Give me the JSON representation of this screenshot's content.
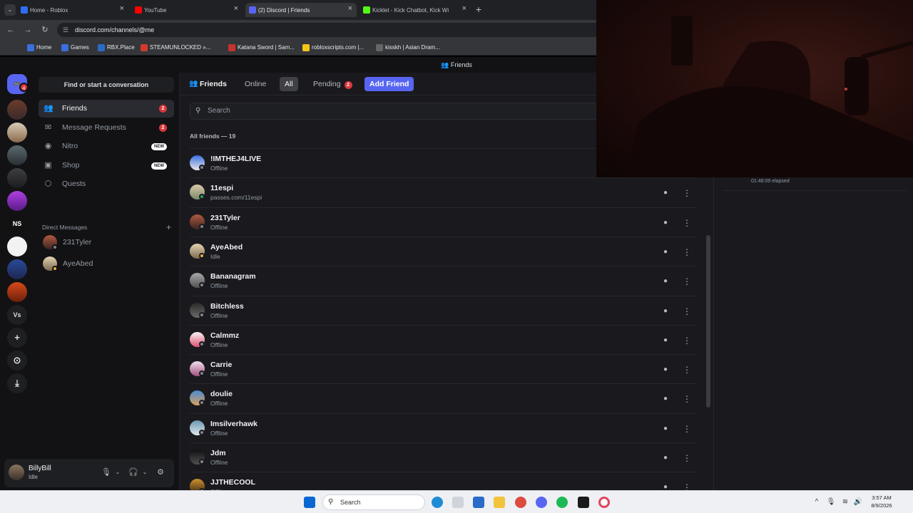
{
  "browser": {
    "tabs": [
      {
        "title": "Home - Roblox",
        "favicon_color": "#2f6df3",
        "active": false
      },
      {
        "title": "YouTube",
        "favicon_color": "#ff0000",
        "active": false
      },
      {
        "title": "(2) Discord | Friends",
        "favicon_color": "#5865f2",
        "active": true
      },
      {
        "title": "Kicklet - Kick Chatbot, Kick Wi",
        "favicon_color": "#53fc18",
        "active": false
      }
    ],
    "url": "discord.com/channels/@me",
    "bookmarks": [
      "Home",
      "Games",
      "RBX.Place",
      "STEAMUNLOCKED »...",
      "Katana Sword | Sam...",
      "robloxscripts.com |...",
      "kisskh | Asian Dram..."
    ]
  },
  "discord": {
    "window_title": "Friends",
    "home_badge": "4",
    "server_label_ns": "NS",
    "server_label_vs": "Vs",
    "find_conversation": "Find or start a conversation",
    "nav": [
      {
        "label": "Friends",
        "icon": "friends-icon",
        "badge": "2"
      },
      {
        "label": "Message Requests",
        "icon": "mail-icon",
        "badge": "2"
      },
      {
        "label": "Nitro",
        "icon": "nitro-icon",
        "tag": "NEW"
      },
      {
        "label": "Shop",
        "icon": "shop-icon",
        "tag": "NEW"
      },
      {
        "label": "Quests",
        "icon": "quests-icon"
      }
    ],
    "direct_messages_label": "Direct Messages",
    "dms": [
      {
        "name": "231Tyler",
        "status_color": "#80848e"
      },
      {
        "name": "AyeAbed",
        "status_color": "#f0b232"
      }
    ],
    "user": {
      "name": "BillyBill",
      "status": "Idle"
    },
    "header": {
      "title": "Friends",
      "tabs": [
        "Online",
        "All",
        "Pending"
      ],
      "selected_tab": "All",
      "pending_count": "2",
      "add_friend": "Add Friend"
    },
    "search_placeholder": "Search",
    "friends_count_label": "All friends — 19",
    "friends": [
      {
        "name": "!IMTHEJ4LIVE",
        "status": "Offline",
        "status_color": "#80848e"
      },
      {
        "name": "11espi",
        "status": "passes.com/11espi",
        "status_color": "#23a55a"
      },
      {
        "name": "231Tyler",
        "status": "Offline",
        "status_color": "#80848e"
      },
      {
        "name": "AyeAbed",
        "status": "Idle",
        "status_color": "#f0b232"
      },
      {
        "name": "Bananagram",
        "status": "Offline",
        "status_color": "#80848e"
      },
      {
        "name": "Bitchless",
        "status": "Offline",
        "status_color": "#80848e"
      },
      {
        "name": "Calmmz",
        "status": "Offline",
        "status_color": "#80848e"
      },
      {
        "name": "Carrie",
        "status": "Offline",
        "status_color": "#80848e"
      },
      {
        "name": "doulie",
        "status": "Offline",
        "status_color": "#80848e"
      },
      {
        "name": "Imsilverhawk",
        "status": "Offline",
        "status_color": "#80848e"
      },
      {
        "name": "Jdm",
        "status": "Offline",
        "status_color": "#80848e"
      },
      {
        "name": "JJTHECOOL",
        "status": "Offline",
        "status_color": "#80848e"
      }
    ],
    "activity_elapsed": "01:48:09 elapsed"
  },
  "taskbar": {
    "search": "Search",
    "time": "3:57 AM",
    "date": "8/9/2026"
  },
  "colors": {
    "accent": "#5865f2",
    "badge": "#da373c"
  }
}
